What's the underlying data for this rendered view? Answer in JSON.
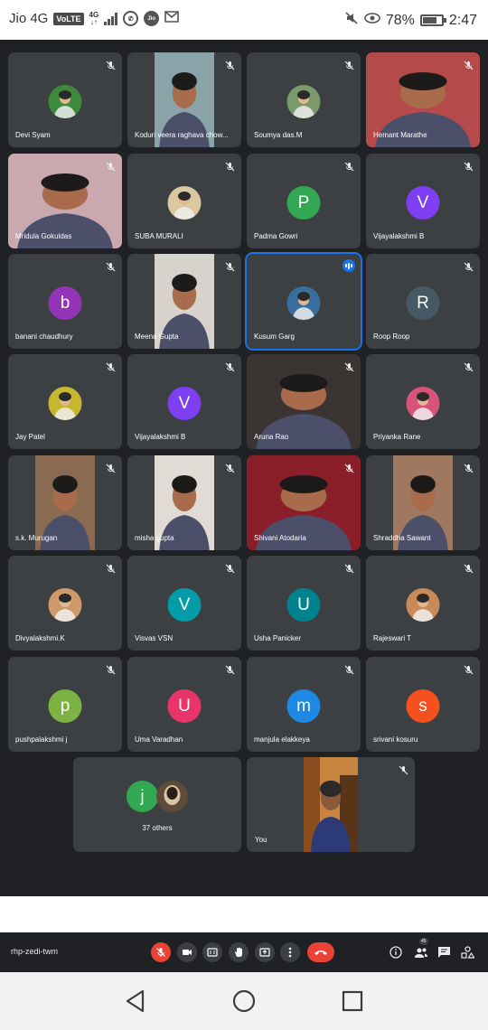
{
  "status_bar": {
    "carrier": "Jio 4G",
    "volte": "VoLTE",
    "net_top": "4G",
    "net_bottom": "↓↑",
    "jio_badge": "Jio",
    "battery": "78%",
    "time": "2:47",
    "battery_level": 0.78,
    "icons": [
      "whatsapp-icon",
      "jio-icon",
      "gmail-icon",
      "mute-icon",
      "eye-comfort-icon",
      "battery-icon"
    ]
  },
  "meeting": {
    "code": "rhp-zedi-twm",
    "others_count": "37 others",
    "others_avatars": [
      {
        "letter": "j",
        "color": "#33a852"
      },
      {
        "letter": "",
        "color": "#5f4b3a"
      }
    ],
    "you_label": "You",
    "participants": [
      {
        "name": "Devi Syam",
        "avatar_type": "photo",
        "photo_color": "#3d8a3a"
      },
      {
        "name": "Koduri veera raghava chow...",
        "avatar_type": "video",
        "photo_color": "#8aa3a8"
      },
      {
        "name": "Soumya das.M",
        "avatar_type": "photo",
        "photo_color": "#7a9a6c"
      },
      {
        "name": "Hemant Marathe",
        "avatar_type": "fullvideo",
        "photo_color": "#b44a4a"
      },
      {
        "name": "Mridula Gokuldas",
        "avatar_type": "fullvideo",
        "photo_color": "#c9a8b0"
      },
      {
        "name": "SUBA MURALI",
        "avatar_type": "photo",
        "photo_color": "#d9c8a0"
      },
      {
        "name": "Padma Gowri",
        "avatar_type": "letter",
        "letter": "P",
        "color": "#33a852"
      },
      {
        "name": "Vijayalakshmi B",
        "avatar_type": "letter",
        "letter": "V",
        "color": "#7e3ff2"
      },
      {
        "name": "banani chaudhury",
        "avatar_type": "letter",
        "letter": "b",
        "color": "#9334b6"
      },
      {
        "name": "Meena Gupta",
        "avatar_type": "video",
        "photo_color": "#d8d2cc"
      },
      {
        "name": "Kusum Garg",
        "avatar_type": "photo",
        "photo_color": "#3a6e9e",
        "speaking": true
      },
      {
        "name": "Roop Roop",
        "avatar_type": "letter",
        "letter": "R",
        "color": "#455a64"
      },
      {
        "name": "Jay Patel",
        "avatar_type": "photo",
        "photo_color": "#c8b830"
      },
      {
        "name": "Vijayalakshmi B",
        "avatar_type": "letter",
        "letter": "V",
        "color": "#7e3ff2"
      },
      {
        "name": "Aruna Rao",
        "avatar_type": "fullvideo",
        "photo_color": "#3a3532"
      },
      {
        "name": "Priyanka Rane",
        "avatar_type": "photo",
        "photo_color": "#d8537a"
      },
      {
        "name": "s.k. Murugan",
        "avatar_type": "video",
        "photo_color": "#8a6a50"
      },
      {
        "name": "misha gupta",
        "avatar_type": "video",
        "photo_color": "#e0dbd5"
      },
      {
        "name": "Shivani Atodaria",
        "avatar_type": "fullvideo",
        "photo_color": "#8a1f2a"
      },
      {
        "name": "Shraddha Sawant",
        "avatar_type": "video",
        "photo_color": "#a07860"
      },
      {
        "name": "Divyalakshmi.K",
        "avatar_type": "photo",
        "photo_color": "#cf9a6a"
      },
      {
        "name": "Visvas VSN",
        "avatar_type": "letter",
        "letter": "V",
        "color": "#009ca8"
      },
      {
        "name": "Usha Panicker",
        "avatar_type": "letter",
        "letter": "U",
        "color": "#00838f"
      },
      {
        "name": "Rajeswari T",
        "avatar_type": "photo",
        "photo_color": "#c98a5a"
      },
      {
        "name": "pushpalakshmi j",
        "avatar_type": "letter",
        "letter": "p",
        "color": "#7cb342"
      },
      {
        "name": "Uma Varadhan",
        "avatar_type": "letter",
        "letter": "U",
        "color": "#e8336b"
      },
      {
        "name": "manjula elakkeya",
        "avatar_type": "letter",
        "letter": "m",
        "color": "#1e88e5"
      },
      {
        "name": "srivani kosuru",
        "avatar_type": "letter",
        "letter": "s",
        "color": "#f4511e"
      }
    ]
  },
  "controls": {
    "participants_badge": "45",
    "icons": [
      "mic-off-icon",
      "camera-icon",
      "captions-icon",
      "raise-hand-icon",
      "present-icon",
      "more-icon",
      "end-call-icon",
      "info-icon",
      "people-icon",
      "chat-icon",
      "activities-icon"
    ]
  },
  "nav": {
    "icons": [
      "back-icon",
      "home-icon",
      "recents-icon"
    ]
  },
  "colors": {
    "meeting_bg": "#202124",
    "tile_bg": "#3c4043",
    "end_call": "#ea4335",
    "speaking_blue": "#1a73e8"
  }
}
